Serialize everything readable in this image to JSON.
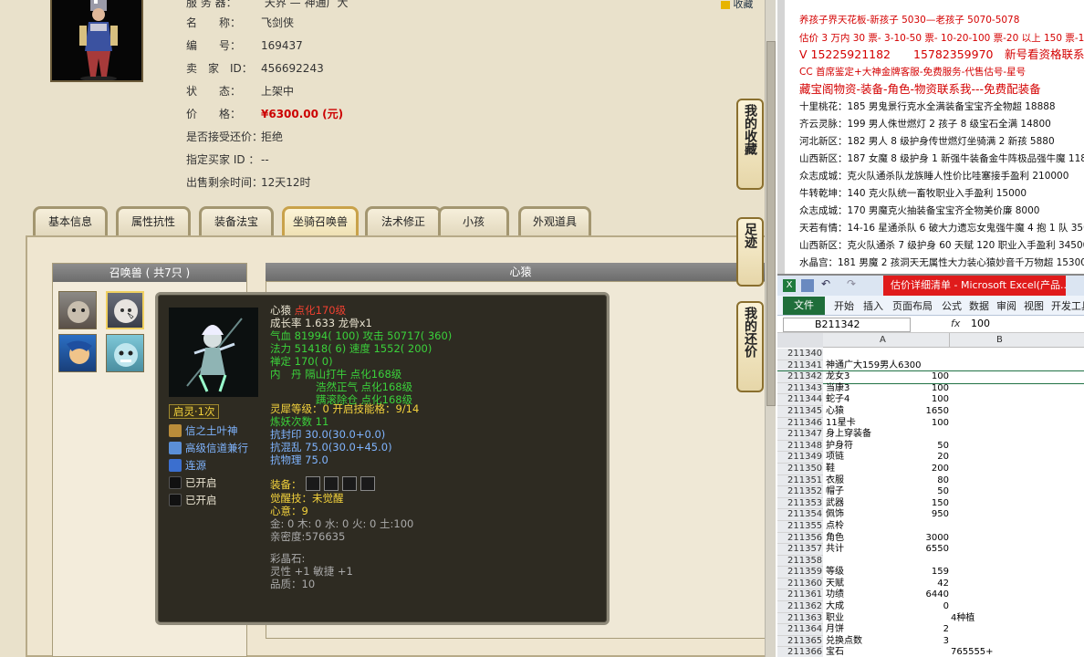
{
  "trade_info": {
    "server_label": "服 务 器：",
    "server_value": "天界 — 神通广大",
    "rows": [
      {
        "label": "名　　称：",
        "value": "飞剑侠"
      },
      {
        "label": "编　　号：",
        "value": "169437"
      },
      {
        "label": "卖　家　ID：",
        "value": "456692243"
      },
      {
        "label": "状　　态：",
        "value": "上架中"
      },
      {
        "label": "价　　格：",
        "value": "¥6300.00 (元)"
      },
      {
        "label": "是否接受还价：",
        "value": "拒绝"
      },
      {
        "label": "指定买家 ID ：",
        "value": "--"
      },
      {
        "label": "出售剩余时间：",
        "value": "12天12时"
      }
    ],
    "corner_link": "收藏"
  },
  "tabs": [
    "基本信息",
    "属性抗性",
    "装备法宝",
    "坐骑召唤兽",
    "法术修正",
    "小孩",
    "外观道具"
  ],
  "active_tab": "坐骑召唤兽",
  "pet_panel": {
    "title": "召唤兽 ( 共7只 )"
  },
  "detail_header": "心猿",
  "side_buttons": [
    "我的收藏",
    "足迹",
    "我的还价"
  ],
  "tooltip": {
    "name": "心猿",
    "name_suffix": "点化170级",
    "growth": "成长率 1.633 龙骨x1",
    "hp": "气血 81994( 100) 攻击 50717( 360)",
    "mp": "法力 51418( 6) 速度 1552( 200)",
    "ding": "禅定 170( 0)",
    "neidan_1": "内　丹 隔山打牛 点化168级",
    "neidan_2": "浩然正气 点化168级",
    "neidan_3": "蹒滚除仓 点化168级",
    "qiling_badge": "启灵·1次",
    "skills": [
      "信之土叶神",
      "高级信道兼行",
      "连源",
      "已开启",
      "已开启"
    ],
    "soul": "灵犀等级：0 开启技能格：9/14",
    "lianhua": "炼妖次数 11",
    "kang_1": "抗封印 30.0(30.0+0.0)",
    "kang_2": "抗混乱 75.0(30.0+45.0)",
    "kang_3": "抗物理 75.0",
    "equip_label": "装备：",
    "awaken": "觉醒技：未觉醒",
    "xinyi": "心意：9",
    "wuxing": "金: 0 木: 0 水: 0 火: 0 土:100",
    "intimacy": "亲密度:576635",
    "caijing": "彩晶石:",
    "caijing_attr": "灵性 +1 敏捷 +1",
    "quality": "品质：10"
  },
  "doc_lines": [
    {
      "text": "养孩子界天花板-新孩子 5030—老孩子 5070-5078",
      "style": "red"
    },
    {
      "text": "估价 3 万内 30 票- 3-10-50 票- 10-20-100 票-20 以上 150 票-1 票",
      "style": "red"
    },
    {
      "text": "V 15225921182　　15782359970　新号看资格联系",
      "style": "red big"
    },
    {
      "text": "CC 首席鉴定+大神金牌客服-免费服务-代售估号-星号",
      "style": "red"
    },
    {
      "text": "藏宝阁物资-装备-角色-物资联系我---免费配装备",
      "style": "red big"
    },
    {
      "text": "十里桃花：185 男鬼景行克水全满装备宝宝齐全物超 18888",
      "style": ""
    },
    {
      "text": "齐云灵脉：199 男人侏世燃灯 2 孩子 8 级宝石全满 14800",
      "style": ""
    },
    {
      "text": "河北新区：182 男人 8 级护身传世燃灯坐骑满 2 新孩 5880",
      "style": ""
    },
    {
      "text": "山西新区：187 女魔 8 级护身 1 新强牛装备金牛阵极品强牛魔 118",
      "style": ""
    },
    {
      "text": "众志成城：克火队通杀队龙族睡人性价比哇塞接手盈利 210000",
      "style": ""
    },
    {
      "text": "牛转乾坤：140 克火队统一畜牧职业入手盈利 15000",
      "style": ""
    },
    {
      "text": "众志成城：170 男魔克火抽装备宝宝齐全物美价廉 8000",
      "style": ""
    },
    {
      "text": "天若有情：14-16 星通杀队 6 破大力遗忘女鬼强牛魔 4 抱 1 队 350",
      "style": ""
    },
    {
      "text": "山西新区：克火队通杀 7 级护身 60 天赋 120 职业入手盈利 34500",
      "style": ""
    },
    {
      "text": "水晶宫：181 男魔 2 孩洞天无属性大力装心猿妙音千万物超 15300",
      "style": ""
    }
  ],
  "excel": {
    "title": "估价详细清单 - Microsoft Excel(产品...",
    "file_tab": "文件",
    "ribbon_tabs": [
      "开始",
      "插入",
      "页面布局",
      "公式",
      "数据",
      "审阅",
      "视图",
      "开发工具"
    ],
    "name_box": "B211342",
    "fx": "fx",
    "formula_value": "100",
    "col_headers": [
      "A",
      "B"
    ],
    "rows": [
      {
        "n": "211340",
        "a": "",
        "b": ""
      },
      {
        "n": "211341",
        "a": "神通广大159男人6300",
        "b": ""
      },
      {
        "n": "211342",
        "a": "龙女3",
        "b": "100"
      },
      {
        "n": "211343",
        "a": "当康3",
        "b": "100"
      },
      {
        "n": "211344",
        "a": "蛇子4",
        "b": "100"
      },
      {
        "n": "211345",
        "a": "心猿",
        "b": "1650"
      },
      {
        "n": "211346",
        "a": "11星卡",
        "b": "100"
      },
      {
        "n": "211347",
        "a": "身上穿装备",
        "b": ""
      },
      {
        "n": "211348",
        "a": "护身符",
        "b": "50"
      },
      {
        "n": "211349",
        "a": "项链",
        "b": "20"
      },
      {
        "n": "211350",
        "a": "鞋",
        "b": "200"
      },
      {
        "n": "211351",
        "a": "衣服",
        "b": "80"
      },
      {
        "n": "211352",
        "a": "帽子",
        "b": "50"
      },
      {
        "n": "211353",
        "a": "武器",
        "b": "150"
      },
      {
        "n": "211354",
        "a": "佩饰",
        "b": "950"
      },
      {
        "n": "211355",
        "a": "点柃",
        "b": ""
      },
      {
        "n": "211356",
        "a": "角色",
        "b": "3000"
      },
      {
        "n": "211357",
        "a": "共计",
        "b": "6550"
      },
      {
        "n": "211358",
        "a": "",
        "b": ""
      },
      {
        "n": "211359",
        "a": "等级",
        "b": "159"
      },
      {
        "n": "211360",
        "a": "天赋",
        "b": "42"
      },
      {
        "n": "211361",
        "a": "功绩",
        "b": "6440"
      },
      {
        "n": "211362",
        "a": "大成",
        "b": "0"
      },
      {
        "n": "211363",
        "a": "职业",
        "b_left": "4种植"
      },
      {
        "n": "211364",
        "a": "月饼",
        "b": "2"
      },
      {
        "n": "211365",
        "a": "兑换点数",
        "b": "3"
      },
      {
        "n": "211366",
        "a": "宝石",
        "b_left": "765555+"
      }
    ]
  }
}
